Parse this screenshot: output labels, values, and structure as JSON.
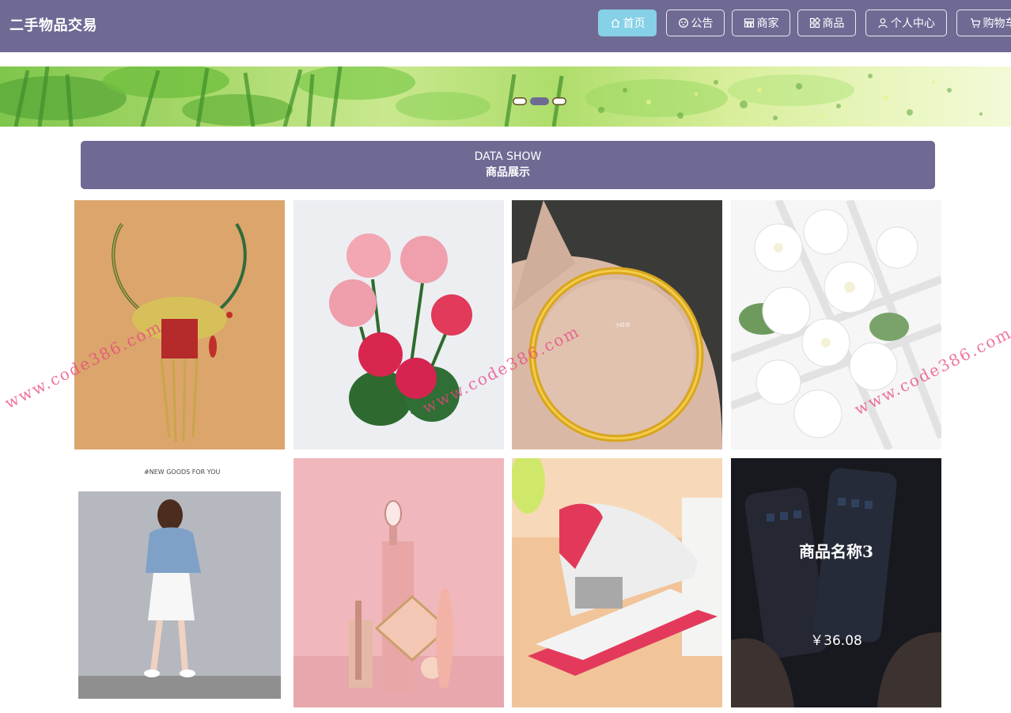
{
  "header": {
    "title": "二手物品交易",
    "nav": [
      {
        "label": "首页",
        "icon": "home-icon",
        "active": true
      },
      {
        "label": "公告",
        "icon": "announcement-icon",
        "active": false
      },
      {
        "label": "商家",
        "icon": "store-icon",
        "active": false
      },
      {
        "label": "商品",
        "icon": "goods-icon",
        "active": false
      },
      {
        "label": "个人中心",
        "icon": "user-icon",
        "active": false
      },
      {
        "label": "购物车",
        "icon": "cart-icon",
        "active": false
      }
    ]
  },
  "banner": {
    "slide_count": 3,
    "active_slide": 2
  },
  "section": {
    "title_en": "DATA SHOW",
    "title_zh": "商品展示"
  },
  "products": [
    {
      "image": "necklace"
    },
    {
      "image": "roses"
    },
    {
      "image": "gold-bangle",
      "image_caption": "小红书"
    },
    {
      "image": "white-flowers"
    },
    {
      "image": "dress-model",
      "image_caption": "#NEW GOODS FOR YOU"
    },
    {
      "image": "makeup-set"
    },
    {
      "image": "stapler"
    },
    {
      "image": "phones",
      "name": "商品名称3",
      "price": "￥36.08"
    }
  ],
  "watermark": "www.code386.com",
  "colors": {
    "primary": "#6e6a94",
    "active_nav": "#86d1e7"
  }
}
